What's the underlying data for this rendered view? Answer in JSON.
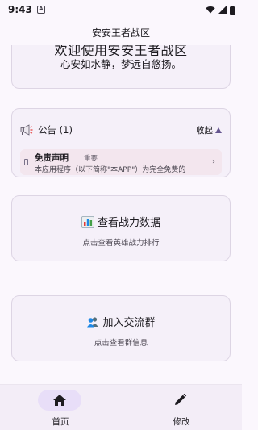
{
  "status_bar": {
    "time": "9:43",
    "alert_glyph": "A"
  },
  "top_bar": {
    "title": "安安王者战区"
  },
  "welcome": {
    "title": "欢迎使用安安王者战区",
    "subtitle": "心安如水静，梦远自悠扬。"
  },
  "notice": {
    "header": "公告 (1)",
    "collapse_label": "收起",
    "items": [
      {
        "title": "免责声明",
        "tag": "重要",
        "text": "本应用程序（以下简称\"本APP\"）为完全免费的"
      }
    ]
  },
  "actions": {
    "power": {
      "title": "查看战力数据",
      "subtitle": "点击查看英雄战力排行"
    },
    "group": {
      "title": "加入交流群",
      "subtitle": "点击查看群信息"
    }
  },
  "bottom_nav": {
    "items": [
      {
        "label": "首页",
        "icon": "home-icon",
        "active": true
      },
      {
        "label": "修改",
        "icon": "pen-icon",
        "active": false
      }
    ]
  },
  "colors": {
    "background": "#fbf7fd",
    "card": "#f5f0f9",
    "notice_item": "#f3e6ee",
    "accent": "#65558f",
    "nav_active_pill": "#e8def8"
  }
}
